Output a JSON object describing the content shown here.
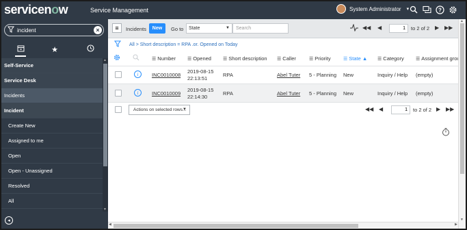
{
  "banner": {
    "logo_text": "servicenow",
    "app_title": "Service Management",
    "user_name": "System Administrator",
    "icons": [
      "search-icon",
      "chat-icon",
      "help-icon",
      "settings-icon"
    ]
  },
  "nav": {
    "filter_value": "incident",
    "items": [
      {
        "label": "Self-Service",
        "kind": "section"
      },
      {
        "label": "Service Desk",
        "kind": "section"
      },
      {
        "label": "Incidents",
        "kind": "selected"
      },
      {
        "label": "Incident",
        "kind": "subsection"
      },
      {
        "label": "Create New",
        "kind": "module"
      },
      {
        "label": "Assigned to me",
        "kind": "module"
      },
      {
        "label": "Open",
        "kind": "module"
      },
      {
        "label": "Open - Unassigned",
        "kind": "module"
      },
      {
        "label": "Resolved",
        "kind": "module"
      },
      {
        "label": "All",
        "kind": "module"
      }
    ]
  },
  "list": {
    "title": "Incidents",
    "new_label": "New",
    "goto_label": "Go to",
    "goto_field": "State",
    "search_placeholder": "Search",
    "pager_top": {
      "page": "1",
      "of": "to 2 of 2"
    },
    "breadcrumb": "All > Short description = RPA .or. Opened on Today",
    "columns": [
      "Number",
      "Opened",
      "Short description",
      "Caller",
      "Priority",
      "State",
      "Category",
      "Assignment group"
    ],
    "rows": [
      {
        "number": "INC0010008",
        "opened_date": "2019-08-15",
        "opened_time": "22:13:51",
        "short_description": "RPA",
        "caller": "Abel Tuter",
        "priority": "5 - Planning",
        "state": "New",
        "category": "Inquiry / Help",
        "assignment_group": "(empty)"
      },
      {
        "number": "INC0010009",
        "opened_date": "2019-08-15",
        "opened_time": "22:14:30",
        "short_description": "RPA",
        "caller": "Abel Tuter",
        "priority": "5 - Planning",
        "state": "New",
        "category": "Inquiry / Help",
        "assignment_group": "(empty)"
      }
    ],
    "actions_label": "Actions on selected rows...",
    "pager_bottom": {
      "page": "1",
      "of": "to 2 of 2"
    }
  }
}
